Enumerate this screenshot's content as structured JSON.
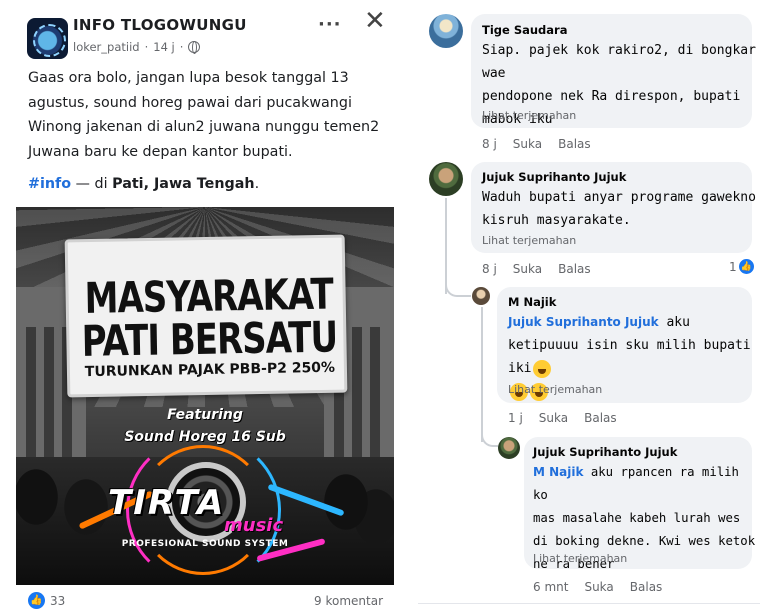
{
  "post": {
    "page_name": "INFO TLOGOWUNGU",
    "author": "loker_patiid",
    "time": "14 j",
    "more": "···",
    "close": "✕",
    "text_lines": [
      "Gaas ora bolo, jangan lupa besok tanggal 13",
      "agustus, sound horeg pawai dari pucakwangi",
      "Winong jakenan di alun2 juwana nunggu temen2",
      "Juwana baru ke depan kantor bupati."
    ],
    "hashtag": "#info",
    "location_prefix": " — di ",
    "location": "Pati, Jawa Tengah",
    "location_suffix": ".",
    "image": {
      "banner_line1": "MASYARAKAT",
      "banner_line2": "PATI BERSATU",
      "banner_line3": "TURUNKAN PAJAK PBB-P2 250%",
      "featuring": "Featuring",
      "subtitle": "Sound Horeg 16 Sub",
      "logo_word1": "TIRTA",
      "logo_word2": "music",
      "logo_tagline": "PROFESIONAL SOUND SYSTEM"
    },
    "reaction_count": "33",
    "like_glyph": "👍",
    "comment_count": "9 komentar"
  },
  "comments": [
    {
      "name": "Tige Saudara",
      "lines": [
        "Siap. pajek kok rakiro2, di bongkar wae",
        "pendopone nek Ra direspon, bupati",
        "mabok iku"
      ],
      "translate": "Lihat terjemahan",
      "time": "8 j",
      "like": "Suka",
      "reply": "Balas"
    },
    {
      "name": "Jujuk Suprihanto Jujuk",
      "lines": [
        "Waduh bupati anyar programe gawekno",
        "kisruh masyarakate."
      ],
      "translate": "Lihat terjemahan",
      "time": "8 j",
      "like": "Suka",
      "reply": "Balas",
      "reactions": "1"
    },
    {
      "name": "M Najik",
      "mention": "Jujuk Suprihanto Jujuk",
      "line1_rest": " aku",
      "line2": "ketipuuuu isin sku milih bupati iki",
      "translate": "Lihat terjemahan",
      "time": "1 j",
      "like": "Suka",
      "reply": "Balas"
    },
    {
      "name": "Jujuk Suprihanto Jujuk",
      "mention": "M Najik",
      "line1_rest": " aku rpancen ra milih ko",
      "lines": [
        "mas masalahe kabeh lurah wes",
        "di boking dekne. Kwi wes ketok",
        "ne ra bener"
      ],
      "translate": "Lihat terjemahan",
      "time": "6 mnt",
      "like": "Suka",
      "reply": "Balas"
    }
  ],
  "colors": {
    "link_blue": "#216fdb",
    "like_blue": "#1877f2",
    "bubble_gray": "#f0f2f5",
    "secondary_text": "#65676b"
  }
}
